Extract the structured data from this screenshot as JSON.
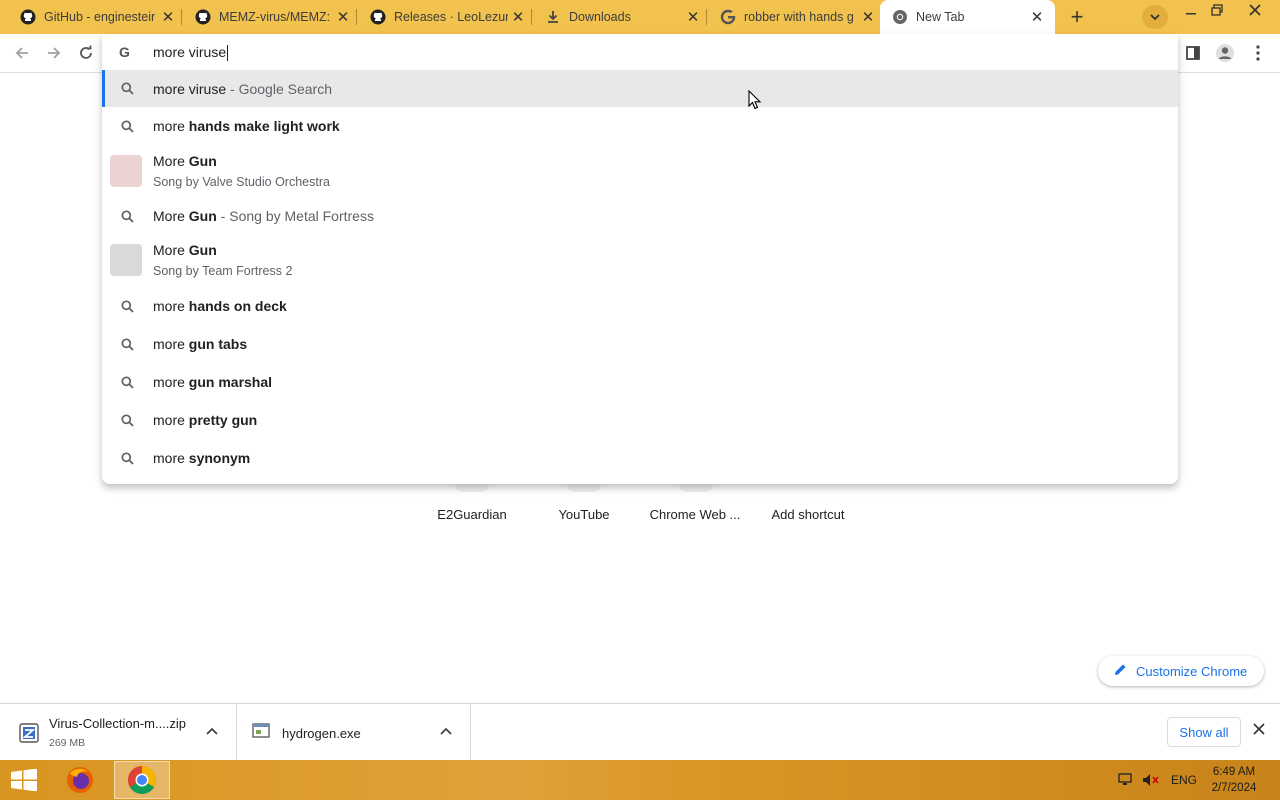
{
  "tabs": [
    {
      "title": "GitHub - enginesteir",
      "icon": "github-icon"
    },
    {
      "title": "MEMZ-virus/MEMZ: ",
      "icon": "github-icon"
    },
    {
      "title": "Releases · LeoLezury",
      "icon": "github-icon"
    },
    {
      "title": "Downloads",
      "icon": "download-icon"
    },
    {
      "title": "robber with hands g",
      "icon": "google-icon"
    },
    {
      "title": "New Tab",
      "icon": "chrome-icon"
    }
  ],
  "omnibox": {
    "query": "more viruse"
  },
  "suggestions": [
    {
      "prefix": "more viruse",
      "bold": "",
      "suffix": " - Google Search",
      "type": "search"
    },
    {
      "prefix": "more ",
      "bold": "hands make light work",
      "suffix": "",
      "type": "search"
    },
    {
      "prefix": "More ",
      "bold": "Gun",
      "subtitle": "Song by Valve Studio Orchestra",
      "type": "entity",
      "thumb_color": "#ecd3d3"
    },
    {
      "prefix": "More ",
      "bold": "Gun",
      "suffix": " - Song by Metal Fortress",
      "type": "search"
    },
    {
      "prefix": "More ",
      "bold": "Gun",
      "subtitle": "Song by Team Fortress 2",
      "type": "entity",
      "thumb_color": "#d9d9d9"
    },
    {
      "prefix": "more ",
      "bold": "hands on deck",
      "suffix": "",
      "type": "search"
    },
    {
      "prefix": "more ",
      "bold": "gun tabs",
      "suffix": "",
      "type": "search"
    },
    {
      "prefix": "more ",
      "bold": "gun marshal",
      "suffix": "",
      "type": "search"
    },
    {
      "prefix": "more ",
      "bold": "pretty gun",
      "suffix": "",
      "type": "search"
    },
    {
      "prefix": "more ",
      "bold": "synonym",
      "suffix": "",
      "type": "search"
    }
  ],
  "shortcuts": [
    "E2Guardian",
    "YouTube",
    "Chrome Web ...",
    "Add shortcut"
  ],
  "customize_label": "Customize Chrome",
  "downloads": [
    {
      "name": "Virus-Collection-m....zip",
      "size": "269 MB",
      "icon": "zip-file-icon"
    },
    {
      "name": "hydrogen.exe",
      "size": "",
      "icon": "exe-file-icon"
    }
  ],
  "downloads_show_all": "Show all",
  "taskbar": {
    "language": "ENG",
    "time": "6:49 AM",
    "date": "2/7/2024"
  },
  "colors": {
    "tabstrip": "#f2c24e",
    "accent": "#1a73e8",
    "taskbar": "#d8951f"
  }
}
